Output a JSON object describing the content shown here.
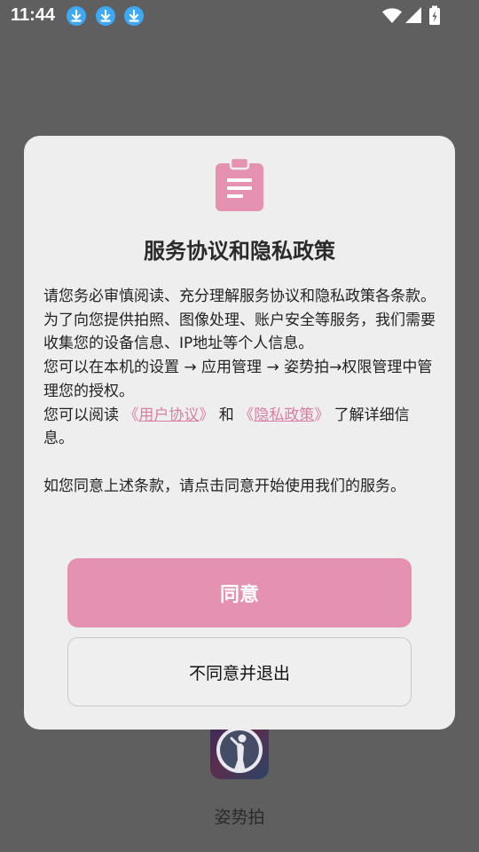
{
  "status_bar": {
    "time": "11:44",
    "notifications": [
      "download-icon",
      "download-icon",
      "download-icon"
    ],
    "icons": [
      "wifi-icon",
      "signal-icon",
      "battery-icon"
    ]
  },
  "background_app": {
    "label": "姿势拍"
  },
  "dialog": {
    "icon": "clipboard-icon",
    "title": "服务协议和隐私政策",
    "paragraphs": {
      "p1": "请您务必审慎阅读、充分理解服务协议和隐私政策各条款。",
      "p2": "为了向您提供拍照、图像处理、账户安全等服务，我们需要收集您的设备信息、IP地址等个人信息。",
      "p3": "您可以在本机的设置 → 应用管理 → 姿势拍→权限管理中管理您的授权。",
      "p4_prefix": "您可以阅读 ",
      "p4_link1": "用户协议",
      "p4_mid": " 和 ",
      "p4_link2": "隐私政策",
      "p4_suffix": " 了解详细信息。",
      "p5": "如您同意上述条款，请点击同意开始使用我们的服务。"
    },
    "agree_label": "同意",
    "exit_label": "不同意并退出"
  },
  "colors": {
    "accent": "#e591b2",
    "link": "#d87fa6",
    "overlay": "#5f5f5f",
    "dialog_bg": "#eeeeee"
  }
}
